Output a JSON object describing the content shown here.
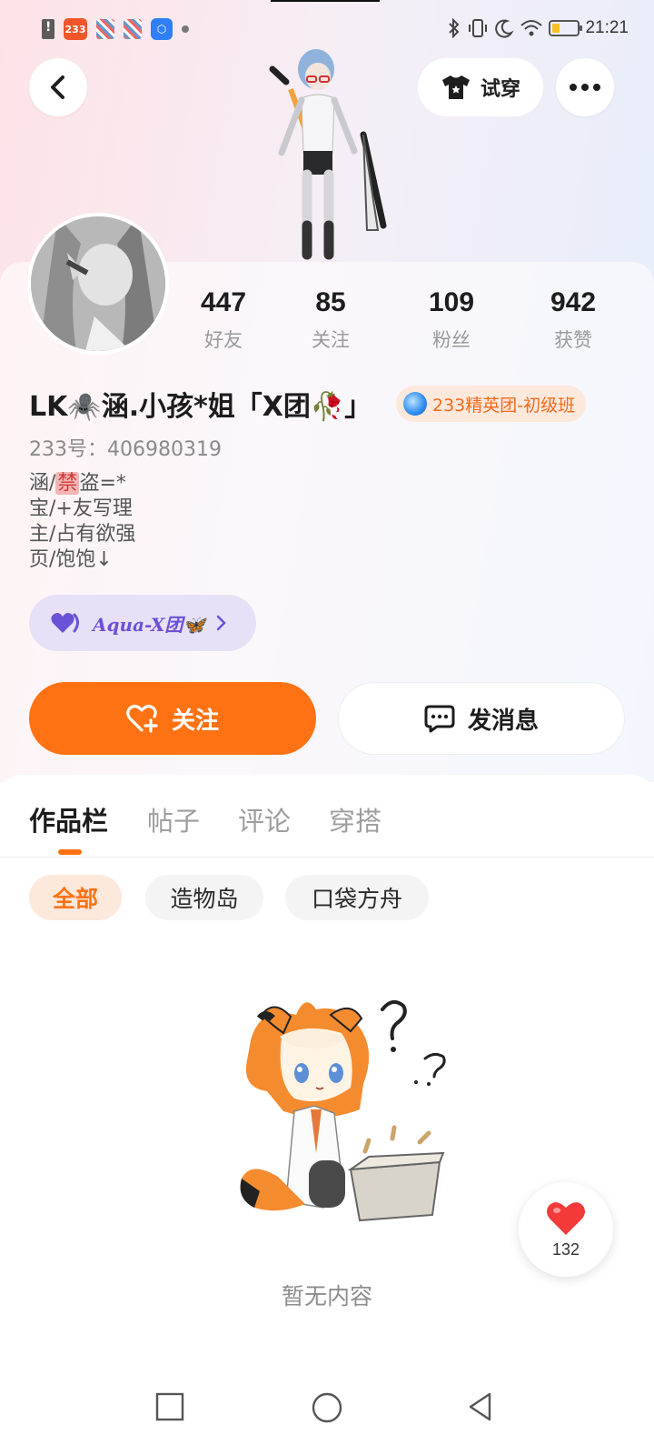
{
  "status_bar": {
    "app_badge": "233",
    "time": "21:21"
  },
  "header": {
    "try_on_label": "试穿"
  },
  "stats": [
    {
      "count": "447",
      "label": "好友"
    },
    {
      "count": "85",
      "label": "关注"
    },
    {
      "count": "109",
      "label": "粉丝"
    },
    {
      "count": "942",
      "label": "获赞"
    }
  ],
  "profile": {
    "name": "LK🕷️涵.小孩*姐「X团🥀」",
    "badge": "233精英团-初级班",
    "uid": "233号：406980319",
    "bio": {
      "line1_prefix": "涵/",
      "line1_ban": "禁",
      "line1_suffix": "盗=*",
      "line2": "宝/+友写理",
      "line3": "主/占有欲强",
      "line4": "页/饱饱↓"
    },
    "group": "Aqua-X团🦋"
  },
  "actions": {
    "follow": "关注",
    "message": "发消息"
  },
  "tabs": [
    "作品栏",
    "帖子",
    "评论",
    "穿搭"
  ],
  "filters": [
    "全部",
    "造物岛",
    "口袋方舟"
  ],
  "empty": {
    "text": "暂无内容"
  },
  "like_button": {
    "count": "132"
  },
  "colors": {
    "accent": "#ff7213",
    "group_purple": "#6b52d6",
    "heart_red": "#f23a3a"
  }
}
